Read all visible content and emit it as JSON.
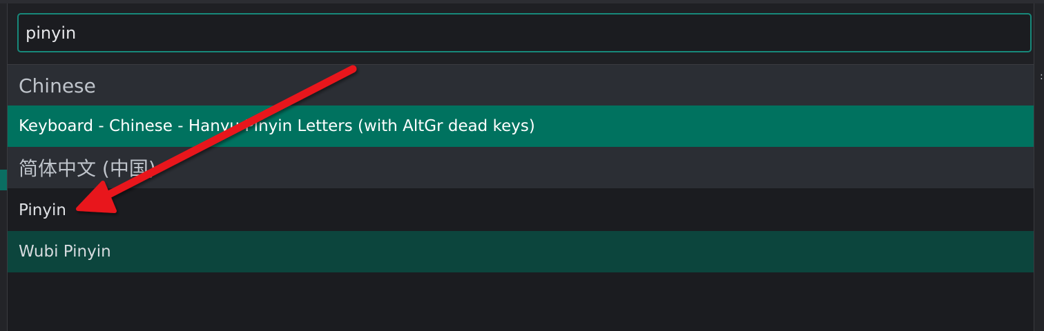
{
  "search": {
    "value": "pinyin"
  },
  "groups": [
    {
      "header": "Chinese",
      "items": [
        {
          "label": "Keyboard - Chinese - Hanyu Pinyin Letters (with AltGr dead keys)",
          "state": "selected"
        }
      ]
    },
    {
      "header": "简体中文 (中国)",
      "items": [
        {
          "label": "Pinyin",
          "state": "normal"
        },
        {
          "label": "Wubi Pinyin",
          "state": "hover"
        }
      ]
    }
  ],
  "annotation": {
    "arrow_color": "#e8151b"
  },
  "colors": {
    "accent": "#17897b",
    "selected": "#00725f",
    "hover": "#0c453d",
    "background": "#1b1c20",
    "group_header_bg": "#2b2e34"
  }
}
